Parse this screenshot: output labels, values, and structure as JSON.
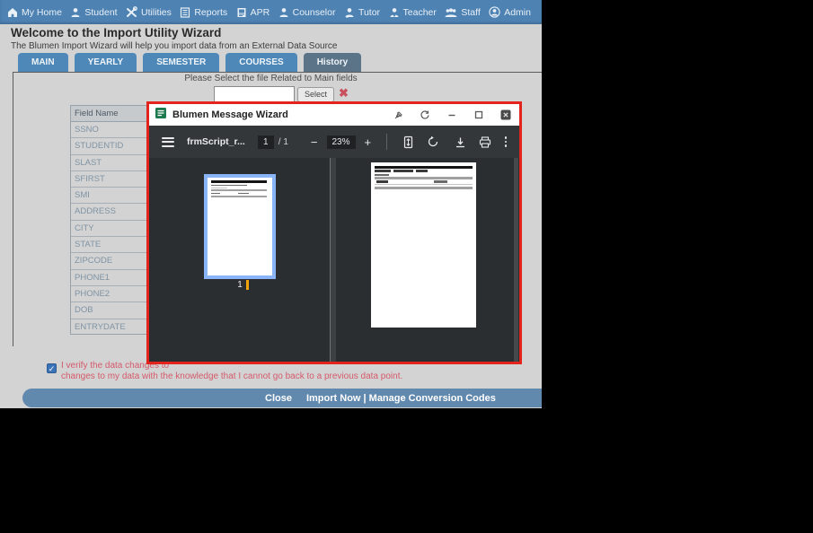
{
  "nav": {
    "items": [
      {
        "label": "My Home",
        "icon": "home-icon"
      },
      {
        "label": "Student",
        "icon": "student-icon"
      },
      {
        "label": "Utilities",
        "icon": "utilities-icon"
      },
      {
        "label": "Reports",
        "icon": "reports-icon"
      },
      {
        "label": "APR",
        "icon": "apr-icon"
      },
      {
        "label": "Counselor",
        "icon": "counselor-icon"
      },
      {
        "label": "Tutor",
        "icon": "tutor-icon"
      },
      {
        "label": "Teacher",
        "icon": "teacher-icon"
      },
      {
        "label": "Staff",
        "icon": "staff-icon"
      },
      {
        "label": "Admin",
        "icon": "admin-icon"
      }
    ]
  },
  "header": {
    "title": "Welcome to the Import Utility Wizard",
    "subtitle": "The Blumen Import Wizard will help you import data from an External Data Source"
  },
  "tabs": [
    {
      "label": "MAIN",
      "active": false
    },
    {
      "label": "YEARLY",
      "active": false
    },
    {
      "label": "SEMESTER",
      "active": false
    },
    {
      "label": "COURSES",
      "active": false
    },
    {
      "label": "History",
      "active": true
    }
  ],
  "file_select": {
    "prompt": "Please Select the file Related to Main fields",
    "input_value": "",
    "select_label": "Select"
  },
  "field_table": {
    "header": "Field Name",
    "rows": [
      "SSNO",
      "STUDENTID",
      "SLAST",
      "SFIRST",
      "SMI",
      "ADDRESS",
      "CITY",
      "STATE",
      "ZIPCODE",
      "PHONE1",
      "PHONE2",
      "DOB",
      "ENTRYDATE"
    ]
  },
  "verify": {
    "checked": true,
    "line1": "I verify the data changes to",
    "line2": "changes to my data with the knowledge that I cannot go back to a previous data point."
  },
  "footer": {
    "close_label": "Close",
    "import_label": "Import Now | Manage Conversion Codes"
  },
  "modal": {
    "title": "Blumen Message Wizard",
    "toolbar": {
      "filename": "frmScript_r...",
      "page_current": "1",
      "page_total": "/ 1",
      "zoom_out": "−",
      "zoom_level": "23%",
      "zoom_in": "+"
    },
    "thumbnail_page_label": "1"
  },
  "colors": {
    "nav_blue": "#4d82b2",
    "tab_blue": "#4e88b8",
    "tab_active": "#5c7488",
    "modal_border_red": "#e2241d",
    "pdf_toolbar_dark": "#33373a",
    "viewer_bg": "#2b2e30",
    "thumb_selection_blue": "#8ab4f8",
    "verify_text_red": "#d45a6b",
    "footer_bar_blue": "#6189ae",
    "checkbox_blue": "#3a73b8"
  }
}
